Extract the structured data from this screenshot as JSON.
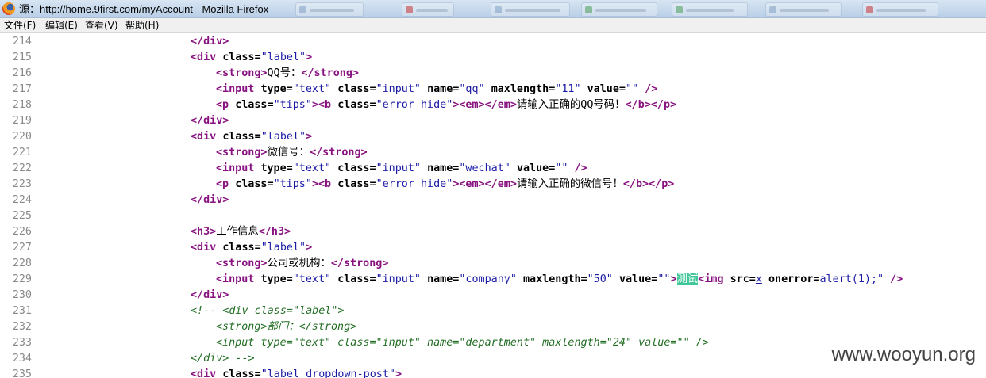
{
  "window": {
    "title": "源：http://home.9first.com/myAccount - Mozilla Firefox"
  },
  "menubar": {
    "items": [
      "文件(F)",
      "编辑(E)",
      "查看(V)",
      "帮助(H)"
    ]
  },
  "source_lines": [
    {
      "num": "214",
      "parts": [
        {
          "t": "tag",
          "s": "</div>"
        }
      ]
    },
    {
      "num": "215",
      "parts": [
        {
          "t": "tag",
          "s": "<div"
        },
        {
          "t": "text",
          "s": " "
        },
        {
          "t": "attr-name",
          "s": "class="
        },
        {
          "t": "attr-value",
          "s": "\"label\""
        },
        {
          "t": "tag",
          "s": ">"
        }
      ]
    },
    {
      "num": "216",
      "parts": [
        {
          "t": "tag",
          "s": "<strong>"
        },
        {
          "t": "text",
          "s": "QQ号："
        },
        {
          "t": "tag",
          "s": "</strong>"
        }
      ]
    },
    {
      "num": "217",
      "parts": [
        {
          "t": "tag",
          "s": "<input"
        },
        {
          "t": "text",
          "s": " "
        },
        {
          "t": "attr-name",
          "s": "type="
        },
        {
          "t": "attr-value",
          "s": "\"text\""
        },
        {
          "t": "text",
          "s": " "
        },
        {
          "t": "attr-name",
          "s": "class="
        },
        {
          "t": "attr-value",
          "s": "\"input\""
        },
        {
          "t": "text",
          "s": " "
        },
        {
          "t": "attr-name",
          "s": "name="
        },
        {
          "t": "attr-value",
          "s": "\"qq\""
        },
        {
          "t": "text",
          "s": " "
        },
        {
          "t": "attr-name",
          "s": "maxlength="
        },
        {
          "t": "attr-value",
          "s": "\"11\""
        },
        {
          "t": "text",
          "s": " "
        },
        {
          "t": "attr-name",
          "s": "value="
        },
        {
          "t": "attr-value",
          "s": "\"\""
        },
        {
          "t": "text",
          "s": " "
        },
        {
          "t": "tag",
          "s": "/>"
        }
      ]
    },
    {
      "num": "218",
      "parts": [
        {
          "t": "tag",
          "s": "<p"
        },
        {
          "t": "text",
          "s": " "
        },
        {
          "t": "attr-name",
          "s": "class="
        },
        {
          "t": "attr-value",
          "s": "\"tips\""
        },
        {
          "t": "tag",
          "s": "><b"
        },
        {
          "t": "text",
          "s": " "
        },
        {
          "t": "attr-name",
          "s": "class="
        },
        {
          "t": "attr-value",
          "s": "\"error hide\""
        },
        {
          "t": "tag",
          "s": "><em></em>"
        },
        {
          "t": "text",
          "s": "请输入正确的QQ号码！"
        },
        {
          "t": "tag",
          "s": "</b></p>"
        }
      ]
    },
    {
      "num": "219",
      "parts": [
        {
          "t": "tag",
          "s": "</div>"
        }
      ]
    },
    {
      "num": "220",
      "parts": [
        {
          "t": "tag",
          "s": "<div"
        },
        {
          "t": "text",
          "s": " "
        },
        {
          "t": "attr-name",
          "s": "class="
        },
        {
          "t": "attr-value",
          "s": "\"label\""
        },
        {
          "t": "tag",
          "s": ">"
        }
      ]
    },
    {
      "num": "221",
      "parts": [
        {
          "t": "tag",
          "s": "<strong>"
        },
        {
          "t": "text",
          "s": "微信号："
        },
        {
          "t": "tag",
          "s": "</strong>"
        }
      ]
    },
    {
      "num": "222",
      "parts": [
        {
          "t": "tag",
          "s": "<input"
        },
        {
          "t": "text",
          "s": " "
        },
        {
          "t": "attr-name",
          "s": "type="
        },
        {
          "t": "attr-value",
          "s": "\"text\""
        },
        {
          "t": "text",
          "s": " "
        },
        {
          "t": "attr-name",
          "s": "class="
        },
        {
          "t": "attr-value",
          "s": "\"input\""
        },
        {
          "t": "text",
          "s": " "
        },
        {
          "t": "attr-name",
          "s": "name="
        },
        {
          "t": "attr-value",
          "s": "\"wechat\""
        },
        {
          "t": "text",
          "s": " "
        },
        {
          "t": "attr-name",
          "s": "value="
        },
        {
          "t": "attr-value",
          "s": "\"\""
        },
        {
          "t": "text",
          "s": " "
        },
        {
          "t": "tag",
          "s": "/>"
        }
      ]
    },
    {
      "num": "223",
      "parts": [
        {
          "t": "tag",
          "s": "<p"
        },
        {
          "t": "text",
          "s": " "
        },
        {
          "t": "attr-name",
          "s": "class="
        },
        {
          "t": "attr-value",
          "s": "\"tips\""
        },
        {
          "t": "tag",
          "s": "><b"
        },
        {
          "t": "text",
          "s": " "
        },
        {
          "t": "attr-name",
          "s": "class="
        },
        {
          "t": "attr-value",
          "s": "\"error hide\""
        },
        {
          "t": "tag",
          "s": "><em></em>"
        },
        {
          "t": "text",
          "s": "请输入正确的微信号！"
        },
        {
          "t": "tag",
          "s": "</b></p>"
        }
      ]
    },
    {
      "num": "224",
      "parts": [
        {
          "t": "tag",
          "s": "</div>"
        }
      ]
    },
    {
      "num": "225",
      "parts": []
    },
    {
      "num": "226",
      "parts": [
        {
          "t": "tag",
          "s": "<h3>"
        },
        {
          "t": "text",
          "s": "工作信息"
        },
        {
          "t": "tag",
          "s": "</h3>"
        }
      ]
    },
    {
      "num": "227",
      "parts": [
        {
          "t": "tag",
          "s": "<div"
        },
        {
          "t": "text",
          "s": " "
        },
        {
          "t": "attr-name",
          "s": "class="
        },
        {
          "t": "attr-value",
          "s": "\"label\""
        },
        {
          "t": "tag",
          "s": ">"
        }
      ]
    },
    {
      "num": "228",
      "parts": [
        {
          "t": "tag",
          "s": "<strong>"
        },
        {
          "t": "text",
          "s": "公司或机构："
        },
        {
          "t": "tag",
          "s": "</strong>"
        }
      ]
    },
    {
      "num": "229",
      "parts": [
        {
          "t": "tag",
          "s": "<input"
        },
        {
          "t": "text",
          "s": " "
        },
        {
          "t": "attr-name",
          "s": "type="
        },
        {
          "t": "attr-value",
          "s": "\"text\""
        },
        {
          "t": "text",
          "s": " "
        },
        {
          "t": "attr-name",
          "s": "class="
        },
        {
          "t": "attr-value",
          "s": "\"input\""
        },
        {
          "t": "text",
          "s": " "
        },
        {
          "t": "attr-name",
          "s": "name="
        },
        {
          "t": "attr-value",
          "s": "\"company\""
        },
        {
          "t": "text",
          "s": " "
        },
        {
          "t": "attr-name",
          "s": "maxlength="
        },
        {
          "t": "attr-value",
          "s": "\"50\""
        },
        {
          "t": "text",
          "s": " "
        },
        {
          "t": "attr-name",
          "s": "value="
        },
        {
          "t": "attr-value",
          "s": "\"\""
        },
        {
          "t": "tag",
          "s": ">"
        },
        {
          "t": "hl",
          "s": "测试"
        },
        {
          "t": "tag",
          "s": "<img"
        },
        {
          "t": "text",
          "s": " "
        },
        {
          "t": "attr-name",
          "s": "src="
        },
        {
          "t": "link",
          "s": "x"
        },
        {
          "t": "text",
          "s": " "
        },
        {
          "t": "attr-name",
          "s": "onerror="
        },
        {
          "t": "attr-value",
          "s": "alert(1);\""
        },
        {
          "t": "text",
          "s": " "
        },
        {
          "t": "tag",
          "s": "/>"
        }
      ]
    },
    {
      "num": "230",
      "parts": [
        {
          "t": "tag",
          "s": "</div>"
        }
      ]
    },
    {
      "num": "231",
      "parts": [
        {
          "t": "comment",
          "s": "<!-- <div class=\"label\">"
        }
      ]
    },
    {
      "num": "232",
      "parts": [
        {
          "t": "comment",
          "s": "<strong>部门：</strong>"
        }
      ]
    },
    {
      "num": "233",
      "parts": [
        {
          "t": "comment",
          "s": "<input type=\"text\" class=\"input\" name=\"department\" maxlength=\"24\" value=\"\" />"
        }
      ]
    },
    {
      "num": "234",
      "parts": [
        {
          "t": "comment",
          "s": "</div> -->"
        }
      ]
    },
    {
      "num": "235",
      "parts": [
        {
          "t": "tag",
          "s": "<div"
        },
        {
          "t": "text",
          "s": " "
        },
        {
          "t": "attr-name",
          "s": "class="
        },
        {
          "t": "attr-value",
          "s": "\"label dropdown-post\""
        },
        {
          "t": "tag",
          "s": ">"
        }
      ]
    }
  ],
  "watermark": "www.wooyun.org",
  "colors": {
    "tag": "#881280",
    "attr_value": "#1a1aa6",
    "comment": "#236e25",
    "line_number": "#8a8a8a",
    "highlight": "#3fc79a"
  }
}
